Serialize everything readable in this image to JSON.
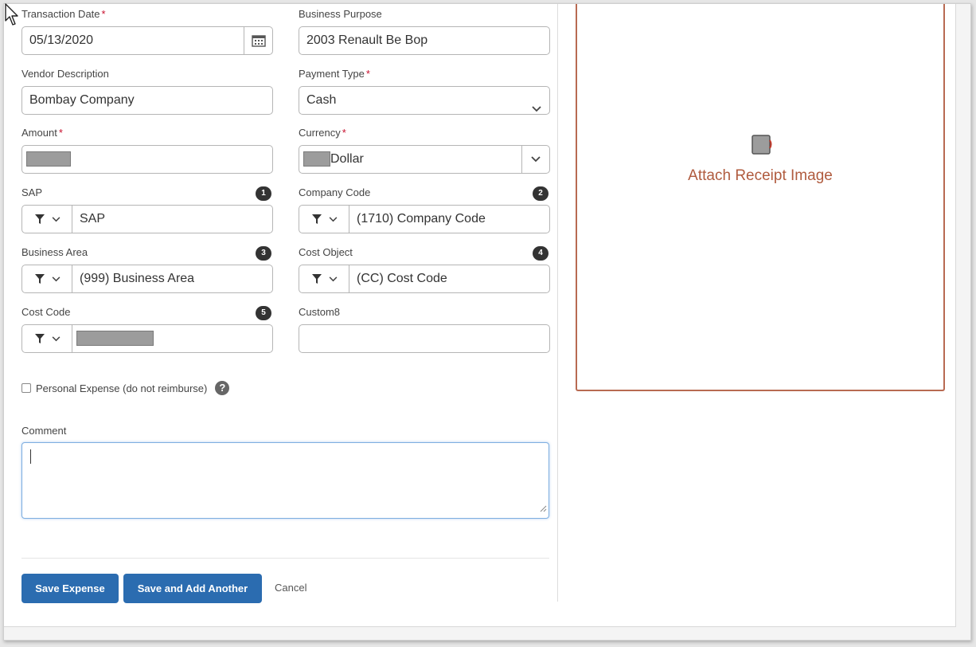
{
  "form": {
    "transaction_date": {
      "label": "Transaction Date",
      "value": "05/13/2020"
    },
    "business_purpose": {
      "label": "Business Purpose",
      "value": "2003 Renault Be Bop"
    },
    "vendor_description": {
      "label": "Vendor Description",
      "value": "Bombay Company"
    },
    "payment_type": {
      "label": "Payment Type",
      "value": "Cash"
    },
    "amount": {
      "label": "Amount"
    },
    "currency": {
      "label": "Currency",
      "value": "Dollar"
    },
    "sap": {
      "label": "SAP",
      "badge": "1",
      "value": "SAP"
    },
    "company_code": {
      "label": "Company Code",
      "badge": "2",
      "value": "(1710) Company Code"
    },
    "business_area": {
      "label": "Business Area",
      "badge": "3",
      "value": "(999) Business Area"
    },
    "cost_object": {
      "label": "Cost Object",
      "badge": "4",
      "value": "(CC) Cost Code"
    },
    "cost_code": {
      "label": "Cost Code",
      "badge": "5"
    },
    "custom8": {
      "label": "Custom8",
      "value": ""
    },
    "required_marker": "*",
    "personal_expense_label": "Personal Expense (do not reimburse)",
    "help_glyph": "?",
    "comment": {
      "label": "Comment",
      "value": ""
    }
  },
  "actions": {
    "save_expense": "Save Expense",
    "save_and_add": "Save and Add Another",
    "cancel": "Cancel"
  },
  "receipt": {
    "label": "Attach Receipt Image"
  },
  "colors": {
    "primary_button": "#2b6cb0",
    "required": "#c8102e",
    "receipt_border": "#b86a52",
    "receipt_text": "#b05b3e"
  },
  "icons": [
    "calendar-icon",
    "chevron-down-icon",
    "filter-icon",
    "help-icon",
    "receipt-icon",
    "resize-handle-icon",
    "mouse-cursor-icon"
  ]
}
